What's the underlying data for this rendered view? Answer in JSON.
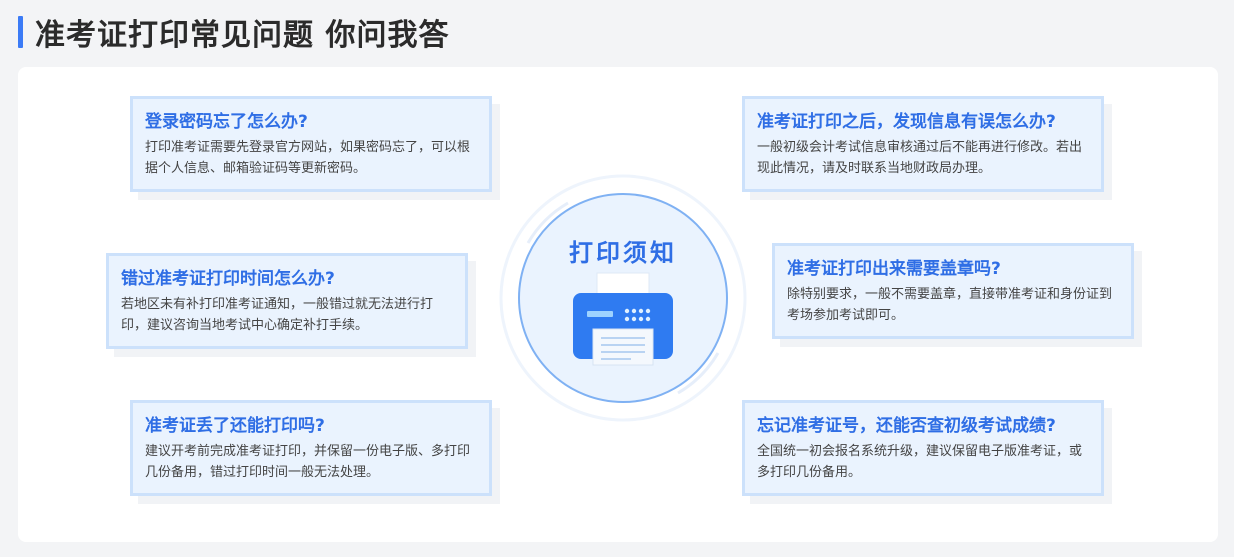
{
  "header": {
    "title": "准考证打印常见问题 你问我答"
  },
  "center": {
    "title": "打印须知",
    "icon": "printer-icon"
  },
  "colors": {
    "accent": "#3b7bf6",
    "card_bg": "#eaf3fe",
    "card_border": "#cce1fb",
    "title_blue": "#2f6ee5"
  },
  "faq": [
    {
      "q": "登录密码忘了怎么办?",
      "a": "打印准考证需要先登录官方网站，如果密码忘了，可以根据个人信息、邮箱验证码等更新密码。"
    },
    {
      "q": "准考证打印之后，发现信息有误怎么办?",
      "a": "一般初级会计考试信息审核通过后不能再进行修改。若出现此情况，请及时联系当地财政局办理。"
    },
    {
      "q": "错过准考证打印时间怎么办?",
      "a": "若地区未有补打印准考证通知，一般错过就无法进行打印，建议咨询当地考试中心确定补打手续。"
    },
    {
      "q": "准考证打印出来需要盖章吗?",
      "a": "除特别要求，一般不需要盖章，直接带准考证和身份证到考场参加考试即可。"
    },
    {
      "q": "准考证丢了还能打印吗?",
      "a": "建议开考前完成准考证打印，并保留一份电子版、多打印几份备用，错过打印时间一般无法处理。"
    },
    {
      "q": "忘记准考证号，还能否查初级考试成绩?",
      "a": "全国统一初会报名系统升级，建议保留电子版准考证，或多打印几份备用。"
    }
  ]
}
